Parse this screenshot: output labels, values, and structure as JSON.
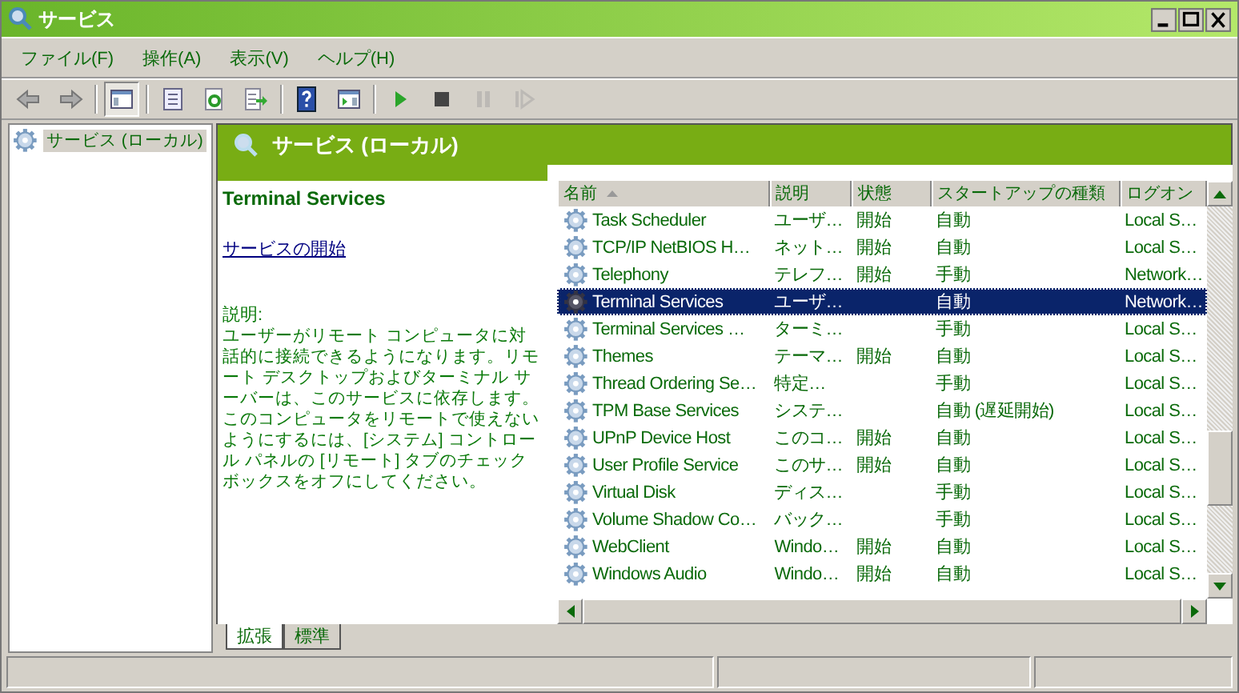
{
  "window": {
    "title": "サービス"
  },
  "menu": [
    "ファイル(F)",
    "操作(A)",
    "表示(V)",
    "ヘルプ(H)"
  ],
  "toolbar": [
    {
      "kind": "back",
      "disabled": false
    },
    {
      "kind": "forward",
      "disabled": false
    },
    {
      "kind": "sep"
    },
    {
      "kind": "tree",
      "disabled": false
    },
    {
      "kind": "sep"
    },
    {
      "kind": "properties",
      "disabled": false
    },
    {
      "kind": "refresh",
      "disabled": false
    },
    {
      "kind": "export",
      "disabled": false
    },
    {
      "kind": "sep"
    },
    {
      "kind": "help",
      "disabled": false
    },
    {
      "kind": "actionpane",
      "disabled": false
    },
    {
      "kind": "sep"
    },
    {
      "kind": "play",
      "disabled": false
    },
    {
      "kind": "stop",
      "disabled": false
    },
    {
      "kind": "pause",
      "disabled": true
    },
    {
      "kind": "resume",
      "disabled": true
    }
  ],
  "tree": [
    {
      "label": "サービス (ローカル)",
      "selected": true
    }
  ],
  "panel": {
    "title": "サービス (ローカル)",
    "detail": {
      "service": "Terminal Services",
      "link": "サービスの開始",
      "desc_label": "説明:",
      "description": "ユーザーがリモート コンピュータに対話的に接続できるようになります。リモート デスクトップおよびターミナル サーバーは、このサービスに依存します。このコンピュータをリモートで使えないようにするには、[システム] コントロール パネルの [リモート] タブのチェックボックスをオフにしてください。"
    },
    "columns": [
      "名前",
      "説明",
      "状態",
      "スタートアップの種類",
      "ログオン"
    ],
    "rows": [
      {
        "name": "Task Scheduler",
        "desc": "ユーザ…",
        "status": "開始",
        "startup": "自動",
        "logon": "Local S…",
        "selected": false
      },
      {
        "name": "TCP/IP NetBIOS H…",
        "desc": "ネット…",
        "status": "開始",
        "startup": "自動",
        "logon": "Local S…",
        "selected": false
      },
      {
        "name": "Telephony",
        "desc": "テレフ…",
        "status": "開始",
        "startup": "手動",
        "logon": "Network…",
        "selected": false
      },
      {
        "name": "Terminal Services",
        "desc": "ユーザ…",
        "status": "",
        "startup": "自動",
        "logon": "Network…",
        "selected": true
      },
      {
        "name": "Terminal Services …",
        "desc": "ターミ…",
        "status": "",
        "startup": "手動",
        "logon": "Local S…",
        "selected": false
      },
      {
        "name": "Themes",
        "desc": "テーマ…",
        "status": "開始",
        "startup": "自動",
        "logon": "Local S…",
        "selected": false
      },
      {
        "name": "Thread Ordering Se…",
        "desc": "特定…",
        "status": "",
        "startup": "手動",
        "logon": "Local S…",
        "selected": false
      },
      {
        "name": "TPM Base Services",
        "desc": "システ…",
        "status": "",
        "startup": "自動 (遅延開始)",
        "logon": "Local S…",
        "selected": false
      },
      {
        "name": "UPnP Device Host",
        "desc": "このコ…",
        "status": "開始",
        "startup": "自動",
        "logon": "Local S…",
        "selected": false
      },
      {
        "name": "User Profile Service",
        "desc": "このサ…",
        "status": "開始",
        "startup": "自動",
        "logon": "Local S…",
        "selected": false
      },
      {
        "name": "Virtual Disk",
        "desc": "ディス…",
        "status": "",
        "startup": "手動",
        "logon": "Local S…",
        "selected": false
      },
      {
        "name": "Volume Shadow Co…",
        "desc": "バック…",
        "status": "",
        "startup": "手動",
        "logon": "Local S…",
        "selected": false
      },
      {
        "name": "WebClient",
        "desc": "Windo…",
        "status": "開始",
        "startup": "自動",
        "logon": "Local S…",
        "selected": false
      },
      {
        "name": "Windows Audio",
        "desc": "Windo…",
        "status": "開始",
        "startup": "自動",
        "logon": "Local S…",
        "selected": false
      }
    ],
    "tabs": [
      {
        "label": "拡張",
        "selected": true
      },
      {
        "label": "標準",
        "selected": false
      }
    ]
  }
}
